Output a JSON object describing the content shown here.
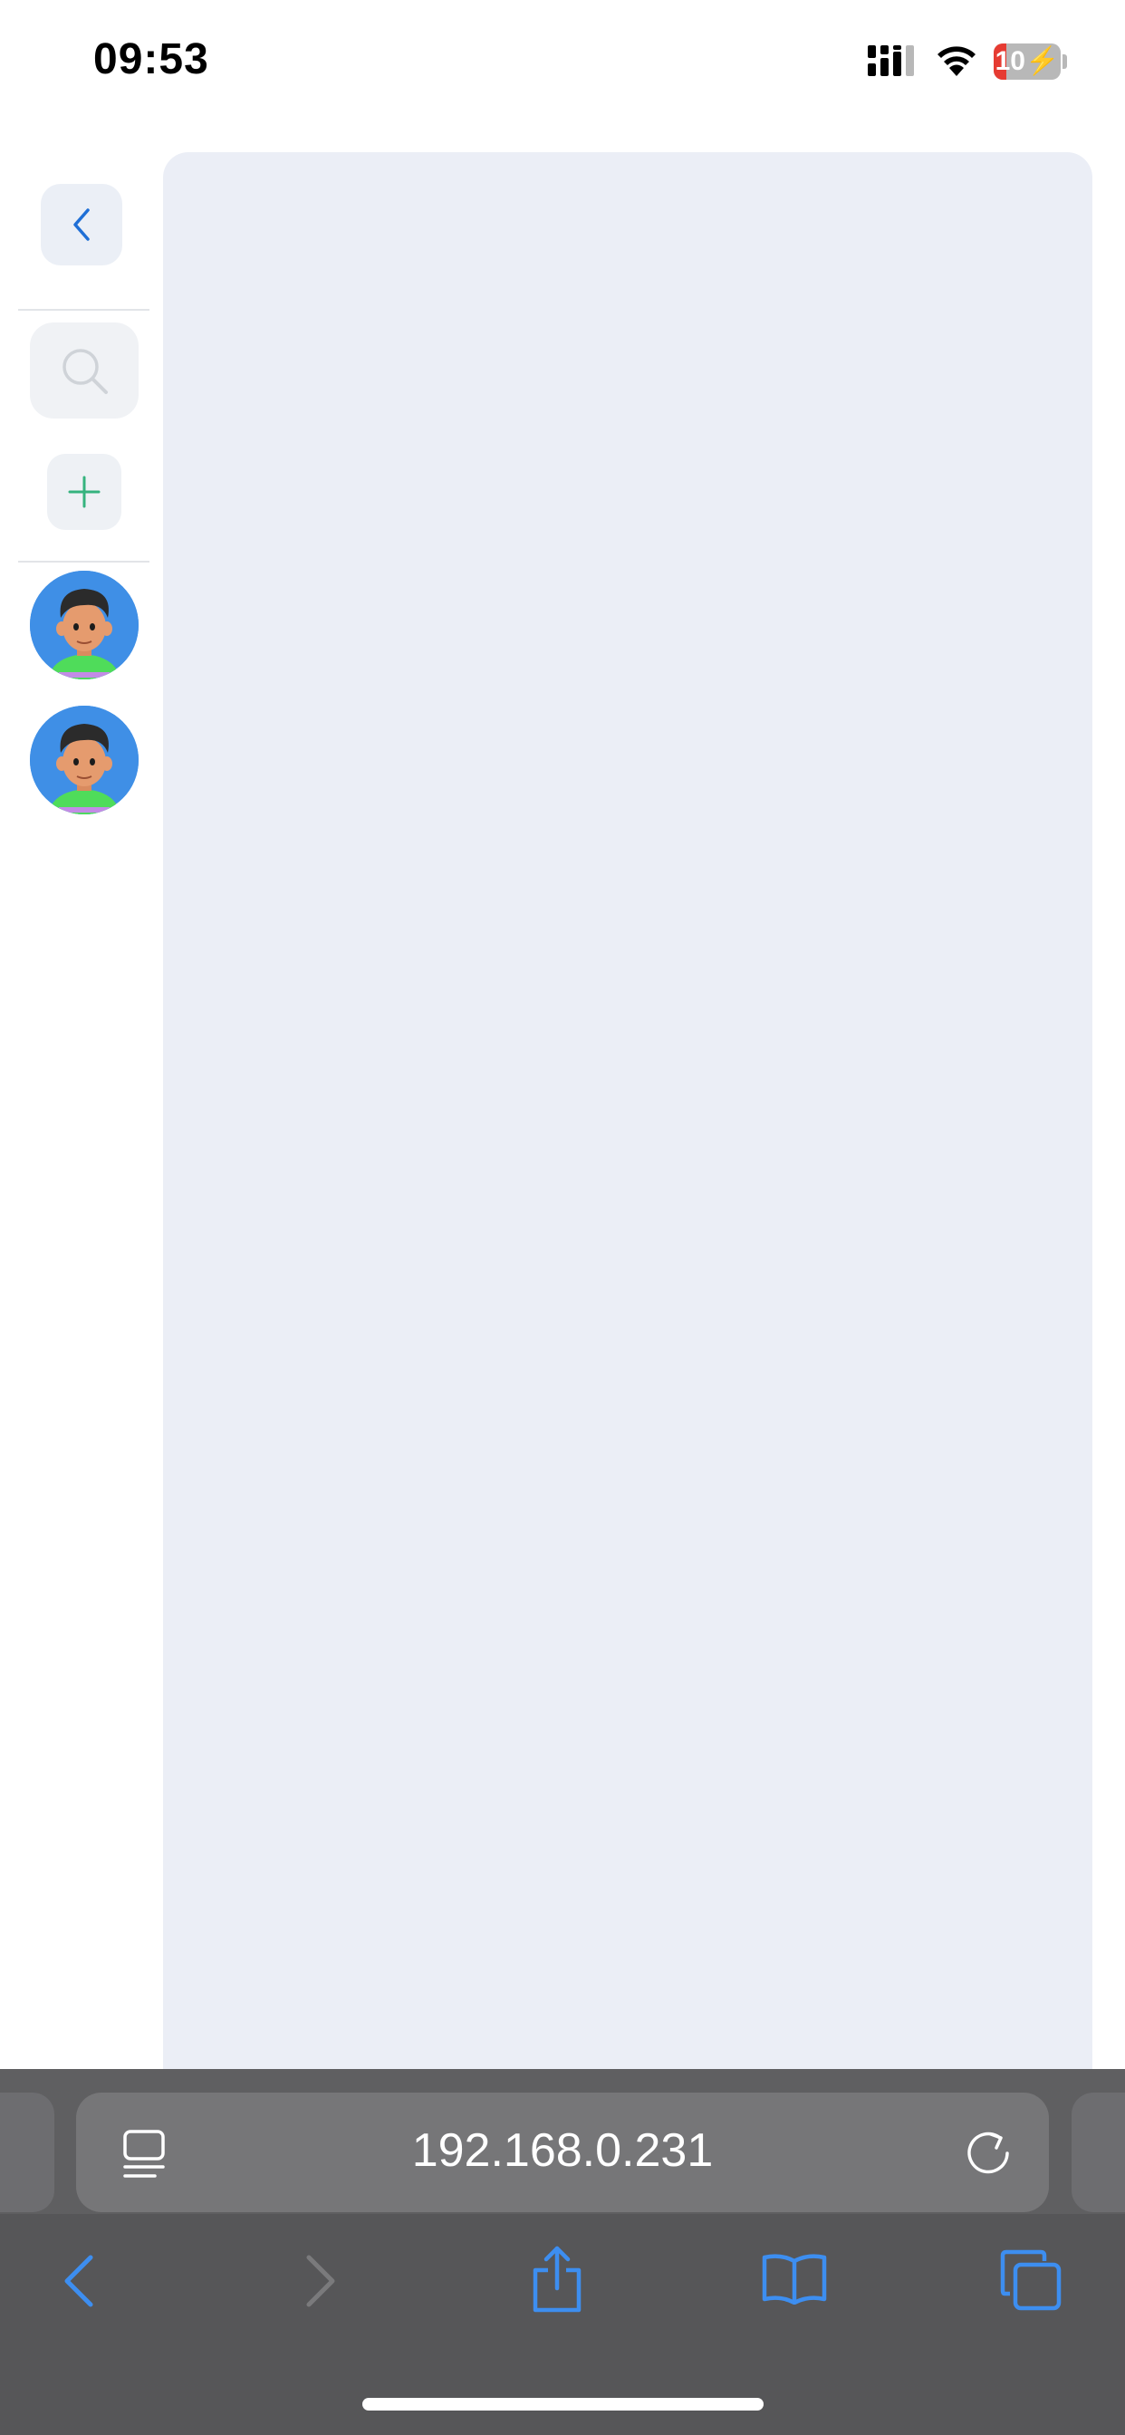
{
  "status_bar": {
    "time": "09:53",
    "battery_level": "10",
    "icons": [
      "cellular-signal-icon",
      "wifi-icon",
      "battery-charging-icon"
    ]
  },
  "sidebar": {
    "back_icon": "chevron-left-icon",
    "search_icon": "search-icon",
    "add_icon": "plus-icon",
    "avatars": [
      "avatar-1",
      "avatar-2"
    ],
    "colors": {
      "accent_blue": "#1f6fd6",
      "accent_green": "#35b37e",
      "avatar_bg": "#3f8fe6"
    }
  },
  "browser": {
    "url": "192.168.0.231",
    "icons": [
      "reader-mode-icon",
      "reload-icon",
      "back-icon",
      "forward-icon",
      "share-icon",
      "bookmarks-icon",
      "tabs-icon"
    ],
    "colors": {
      "toolbar_bg": "#565658",
      "icon_blue": "#3d8ef0"
    }
  }
}
